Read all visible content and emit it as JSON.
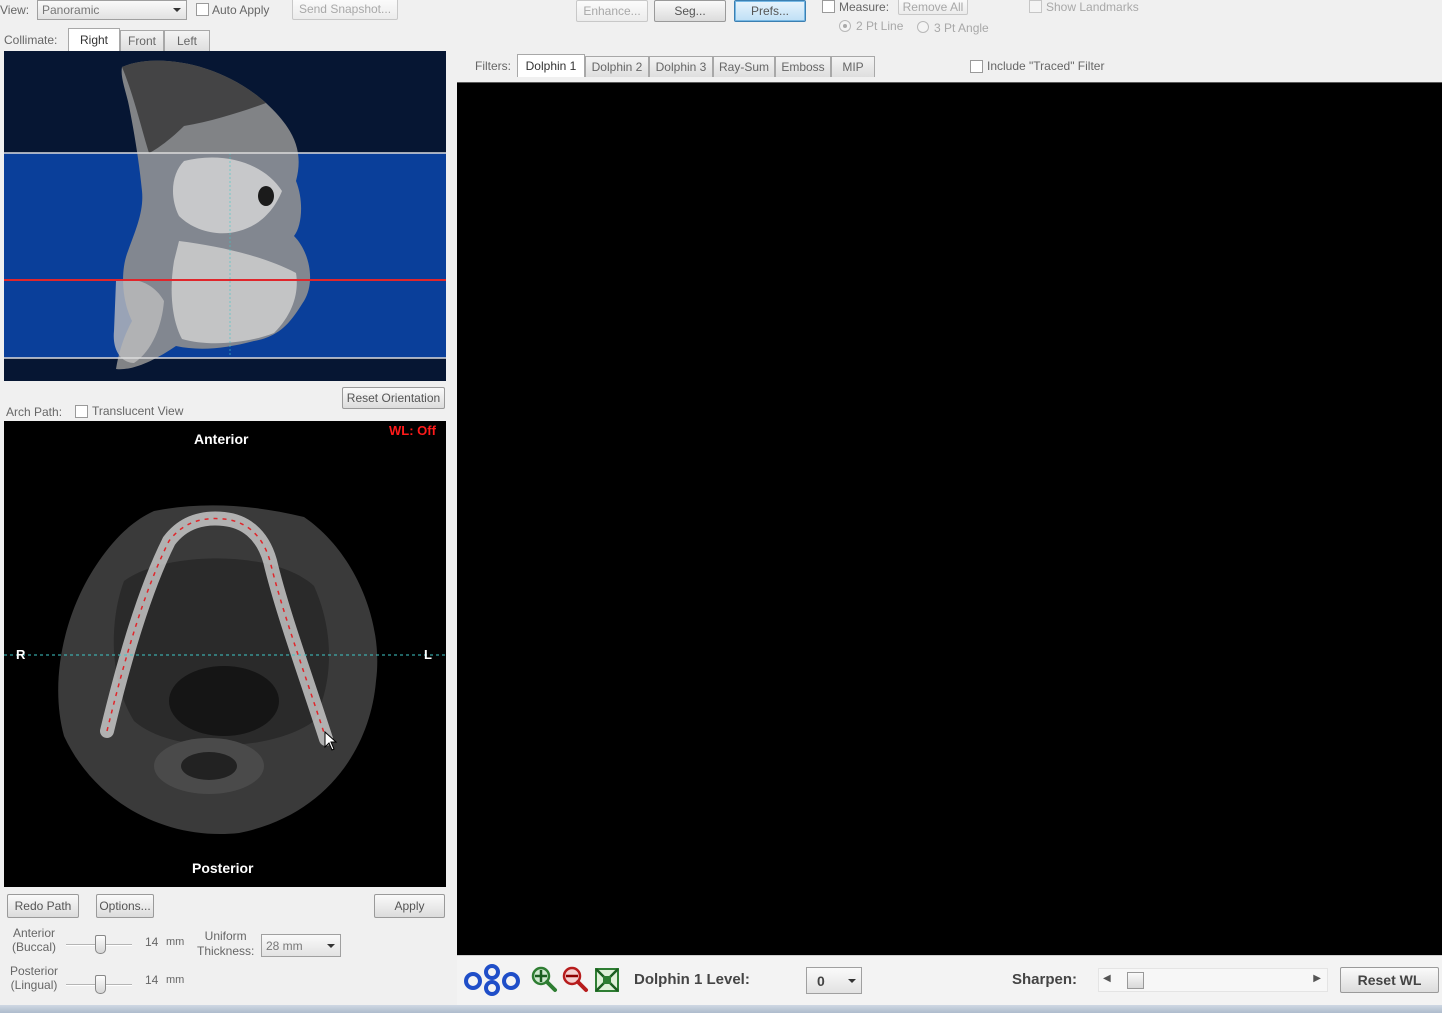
{
  "toolbar": {
    "view_label": "View:",
    "view_value": "Panoramic",
    "auto_apply": "Auto Apply",
    "send_snapshot": "Send Snapshot...",
    "enhance": "Enhance...",
    "seg": "Seg...",
    "prefs": "Prefs...",
    "measure": "Measure:",
    "remove_all": "Remove All",
    "pt2_line": "2 Pt Line",
    "pt3_angle": "3 Pt Angle",
    "show_landmarks": "Show Landmarks"
  },
  "collimate": {
    "label": "Collimate:",
    "tabs": [
      "Right",
      "Front",
      "Left"
    ],
    "selected": "Right"
  },
  "filters": {
    "label": "Filters:",
    "tabs": [
      "Dolphin 1",
      "Dolphin 2",
      "Dolphin 3",
      "Ray-Sum",
      "Emboss",
      "MIP"
    ],
    "selected": "Dolphin 1",
    "include_traced": "Include \"Traced\" Filter"
  },
  "arch": {
    "path_label": "Arch Path:",
    "translucent": "Translucent View",
    "reset_orientation": "Reset Orientation",
    "anterior": "Anterior",
    "posterior": "Posterior",
    "wl": "WL: Off",
    "right": "R",
    "left": "L"
  },
  "path_controls": {
    "redo_path": "Redo Path",
    "options": "Options...",
    "apply": "Apply",
    "anterior_label": "Anterior\n(Buccal)",
    "anterior_value": "14",
    "posterior_label": "Posterior\n(Lingual)",
    "posterior_value": "14",
    "unit": "mm",
    "uniform_label": "Uniform\nThickness:",
    "uniform_value": "28 mm"
  },
  "bottom_bar": {
    "level_label": "Dolphin 1 Level:",
    "level_value": "0",
    "sharpen_label": "Sharpen:",
    "reset_wl": "Reset WL",
    "sharpen_level": 0.05
  },
  "colors": {
    "viewport_bg": "#000000",
    "scene_blue": "#0a3f9a",
    "scene_dark": "#071c3f",
    "wl_red": "#ff1a1a",
    "path_red": "#e0262b",
    "guide_cyan": "#3fc7c7",
    "logo_blue": "#1f4ec8"
  },
  "icons": [
    "dolphin-logo-icon",
    "zoom-in-icon",
    "zoom-out-icon",
    "fit-view-icon",
    "mouse-cursor-icon"
  ]
}
